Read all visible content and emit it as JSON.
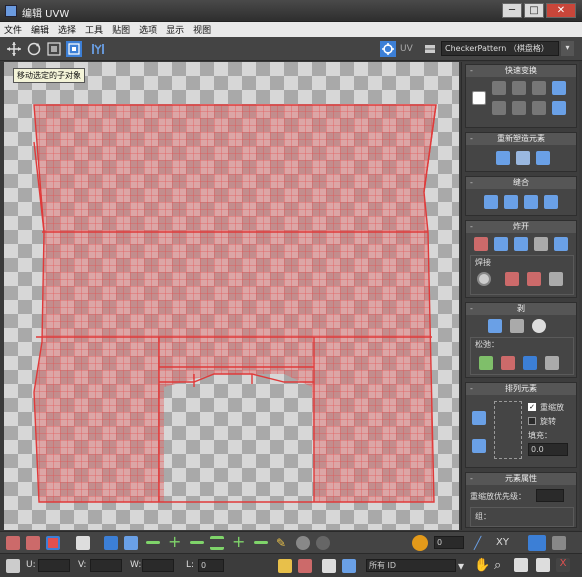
{
  "window": {
    "title": "编辑 UVW",
    "min_label": "─",
    "max_label": "□",
    "close_label": "✕"
  },
  "menu": [
    "文件",
    "编辑",
    "选择",
    "工具",
    "贴图",
    "选项",
    "显示",
    "视图"
  ],
  "toolbar": {
    "uv_label": "UV",
    "map_dropdown": "CheckerPattern （棋盘格）"
  },
  "tooltip": "移动选定的子对象",
  "panel": {
    "quick_transform": "快速变换",
    "reshape": "重新塑造元素",
    "stitch": "缝合",
    "explode": "炸开",
    "weld": "焊接",
    "peel": "剥",
    "detach_label": "松弛：",
    "arrange": "排列元素",
    "rescale_label": "重缩放",
    "rotate_label": "旋转",
    "padding_label": "填充：",
    "padding_value": "0.0",
    "element_props": "元素属性",
    "rescale_priority": "重缩放优先级：",
    "group_label": "组："
  },
  "status": {
    "u_label": "U:",
    "v_label": "V:",
    "w_label": "W:",
    "l_label": "L:",
    "spin_value": "0",
    "all_ids": "所有 ID",
    "xy_label": "XY",
    "x_label": "X"
  },
  "colors": {
    "accent": "#3c7fd6",
    "seam": "#e03a3a",
    "mesh": "#e54a4a",
    "checker_light": "#d7d7d7",
    "checker_dark": "#a9a9a9"
  }
}
